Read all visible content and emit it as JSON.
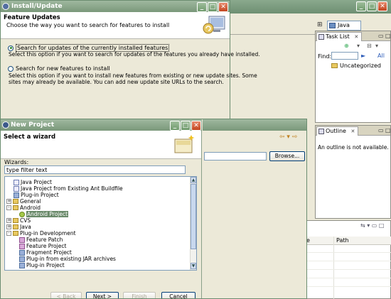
{
  "workbench": {
    "perspective_label": "Java",
    "task_list": {
      "tab_label": "Task List",
      "find_label": "Find:",
      "all_label": "All",
      "category": "Uncategorized"
    },
    "outline": {
      "tab_label": "Outline",
      "message": "An outline is not available."
    },
    "problems": {
      "columns": [
        "e",
        "Path"
      ]
    },
    "browse_label": "Browse..."
  },
  "install_dialog": {
    "title": "Install/Update",
    "header_title": "Feature Updates",
    "header_subtitle": "Choose the way you want to search for features to install",
    "options": [
      {
        "label": "Search for updates of the currently installed features",
        "selected": true,
        "description": [
          "Select this option if you want to search for updates of the features you already have installed."
        ]
      },
      {
        "label": "Search for new features to install",
        "selected": false,
        "description": [
          "Select this option if you want to install new features from existing or new update sites. Some",
          "sites may already be available. You can add new update site URLs to the search."
        ]
      }
    ]
  },
  "new_project_dialog": {
    "title": "New Project",
    "header_title": "Select a wizard",
    "wizards_label": "Wizards:",
    "filter_value": "type filter text",
    "tree": [
      {
        "label": "Java Project",
        "icon": "project-icon",
        "indent": 1,
        "twisty": ""
      },
      {
        "label": "Java Project from Existing Ant Buildfile",
        "icon": "project-icon",
        "indent": 1,
        "twisty": ""
      },
      {
        "label": "Plug-in Project",
        "icon": "plugin-icon",
        "indent": 1,
        "twisty": ""
      },
      {
        "label": "General",
        "icon": "folder-icon",
        "indent": 0,
        "twisty": "+"
      },
      {
        "label": "Android",
        "icon": "folder-icon",
        "indent": 0,
        "twisty": "-"
      },
      {
        "label": "Android Project",
        "icon": "android-icon",
        "indent": 2,
        "twisty": "",
        "selected": true
      },
      {
        "label": "CVS",
        "icon": "folder-icon",
        "indent": 0,
        "twisty": "+"
      },
      {
        "label": "Java",
        "icon": "folder-icon",
        "indent": 0,
        "twisty": "+"
      },
      {
        "label": "Plug-in Development",
        "icon": "folder-icon",
        "indent": 0,
        "twisty": "-"
      },
      {
        "label": "Feature Patch",
        "icon": "feature-icon",
        "indent": 2,
        "twisty": ""
      },
      {
        "label": "Feature Project",
        "icon": "feature-icon",
        "indent": 2,
        "twisty": ""
      },
      {
        "label": "Fragment Project",
        "icon": "plugin-icon",
        "indent": 2,
        "twisty": ""
      },
      {
        "label": "Plug-in from existing JAR archives",
        "icon": "plugin-icon",
        "indent": 2,
        "twisty": ""
      },
      {
        "label": "Plug-in Project",
        "icon": "plugin-icon",
        "indent": 2,
        "twisty": ""
      }
    ],
    "buttons": {
      "back": "< Back",
      "next": "Next >",
      "finish": "Finish",
      "cancel": "Cancel"
    }
  },
  "colors": {
    "titlebar": "#8aa98d",
    "close": "#c2451f",
    "selection": "#6a8a6a"
  }
}
